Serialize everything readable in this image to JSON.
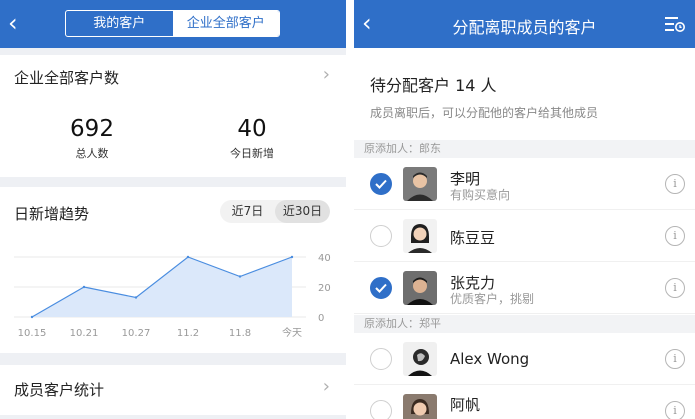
{
  "left": {
    "back_glyph": "‹",
    "tabs": [
      {
        "label": "我的客户",
        "active": false
      },
      {
        "label": "企业全部客户",
        "active": true
      }
    ],
    "summary": {
      "title": "企业全部客户数",
      "stats": [
        {
          "value": "692",
          "label": "总人数"
        },
        {
          "value": "40",
          "label": "今日新增"
        }
      ]
    },
    "trend": {
      "title": "日新增趋势",
      "ranges": [
        {
          "label": "近7日",
          "active": false
        },
        {
          "label": "近30日",
          "active": true
        }
      ]
    },
    "member_stats": {
      "title": "成员客户统计"
    },
    "chevron_glyph": "›"
  },
  "chart_data": {
    "type": "area",
    "x": [
      "10.15",
      "10.21",
      "10.27",
      "11.2",
      "11.8",
      "今天"
    ],
    "series": [
      {
        "values": [
          0,
          20,
          13,
          40,
          27,
          40
        ]
      }
    ],
    "ylim": [
      0,
      40
    ],
    "yticks": [
      "40",
      "20",
      "0"
    ],
    "grid": true,
    "colors": {
      "line": "#4a8de0",
      "fill": "#dbe8fa"
    }
  },
  "right": {
    "title": "分配离职成员的客户",
    "pending_label": "待分配客户 14 人",
    "hint": "成员离职后，可以分配他的客户给其他成员",
    "groups": [
      {
        "added_by": "原添加人：郎东",
        "customers": [
          {
            "name": "李明",
            "note": "有购买意向",
            "checked": true
          },
          {
            "name": "陈豆豆",
            "note": "",
            "checked": false
          },
          {
            "name": "张克力",
            "note": "优质客户，挑剔",
            "checked": true
          }
        ]
      },
      {
        "added_by": "原添加人：郑平",
        "customers": [
          {
            "name": "Alex Wong",
            "note": "",
            "checked": false
          },
          {
            "name": "阿帆",
            "note": "",
            "checked": false
          }
        ]
      }
    ],
    "info_glyph": "i"
  },
  "colors": {
    "brand": "#2f6fc8",
    "page_bg": "#eef0f4"
  }
}
